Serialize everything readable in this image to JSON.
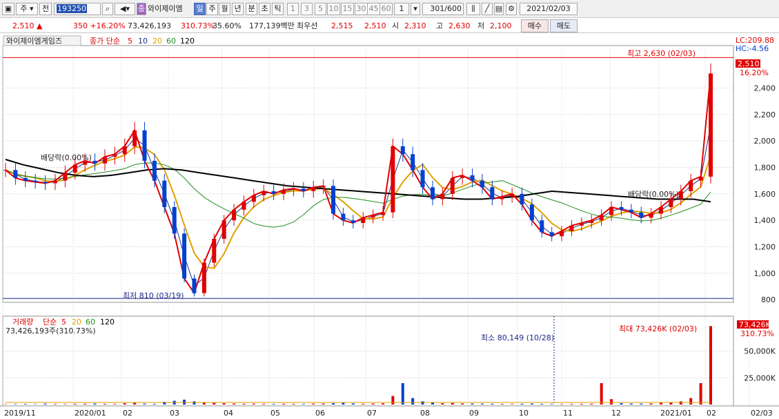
{
  "toolbar": {
    "market": "주",
    "kind": "전",
    "code": "193250",
    "badge": "종",
    "name": "와이제이엠",
    "periods": [
      "일",
      "주",
      "월",
      "년",
      "분",
      "초",
      "틱"
    ],
    "nums": [
      "1",
      "3",
      "5",
      "10",
      "15",
      "30",
      "45",
      "60"
    ],
    "unit": "1",
    "count": "301",
    "total": "/600",
    "date": "2021/02/03"
  },
  "quote": {
    "price": "2,510",
    "arrow": "▲",
    "change": "350",
    "rate": "+16.20%",
    "volume": "73,426,193",
    "vol_rate": "310.73%",
    "turnover": "35.60%",
    "amount": "177,139백만",
    "pref_label": "최우선",
    "ask": "2,515",
    "bid": "2,510",
    "open_label": "시",
    "open": "2,310",
    "high_label": "고",
    "high": "2,630",
    "low_label": "저",
    "low": "2,100",
    "buy": "매수",
    "sell": "매도"
  },
  "legend": {
    "name": "와이제이엠게임즈",
    "ma_label": "종가 단순",
    "periods": [
      "5",
      "10",
      "20",
      "60",
      "120"
    ]
  },
  "vol_legend": {
    "label": "거래량",
    "ma_label": "단순",
    "periods": [
      "5",
      "20",
      "60",
      "120"
    ],
    "value": "73,426,193주(310.73%)"
  },
  "annotations": {
    "lc": "LC:209.88",
    "hc": "HC:-4.56",
    "last_price": "2,510",
    "last_rate": "16.20%",
    "high": "최고 2,630 (02/03)",
    "low": "최저 810 (03/19)",
    "div1": "배당락(0.00%)",
    "div2": "배당락(0.00%)",
    "vol_max": "최대 73,426K (02/03)",
    "vol_min": "최소 80,149 (10/28)",
    "vol_last": "73,426K",
    "vol_rate": "310.73%"
  },
  "colors": {
    "up": "#e00000",
    "down": "#0040d0",
    "ma5": "#e00000",
    "ma10": "#203080",
    "ma20": "#e0a000",
    "ma60": "#209020",
    "ma120": "#000000"
  },
  "chart_data": {
    "type": "candlestick",
    "price_axis": {
      "ticks": [
        800,
        1000,
        1200,
        1400,
        1600,
        1800,
        2000,
        2200,
        2400
      ],
      "range": [
        780,
        2700
      ]
    },
    "volume_axis": {
      "ticks": [
        "25,000K",
        "50,000K"
      ],
      "max_k": 75000
    },
    "x_labels": [
      "2019/11",
      "2020/01",
      "02",
      "03",
      "04",
      "05",
      "06",
      "07",
      "08",
      "09",
      "10",
      "11",
      "12",
      "2021/01",
      "02",
      "02/03"
    ],
    "weekly_close": [
      1780,
      1720,
      1700,
      1690,
      1680,
      1700,
      1760,
      1820,
      1850,
      1830,
      1880,
      1900,
      1960,
      2080,
      1850,
      1700,
      1500,
      1300,
      960,
      850,
      1080,
      1260,
      1400,
      1480,
      1540,
      1590,
      1620,
      1600,
      1630,
      1640,
      1620,
      1650,
      1660,
      1450,
      1400,
      1380,
      1420,
      1440,
      1460,
      1960,
      1900,
      1780,
      1650,
      1560,
      1600,
      1720,
      1740,
      1700,
      1650,
      1560,
      1580,
      1600,
      1520,
      1400,
      1310,
      1280,
      1320,
      1360,
      1380,
      1400,
      1440,
      1500,
      1480,
      1460,
      1420,
      1450,
      1500,
      1560,
      1620,
      1700,
      1730,
      2510
    ],
    "series": [
      {
        "name": "5",
        "values": [
          1780,
          1720,
          1700,
          1690,
          1680,
          1700,
          1760,
          1820,
          1850,
          1830,
          1880,
          1900,
          1960,
          2080,
          1850,
          1700,
          1500,
          1300,
          960,
          850,
          1080,
          1260,
          1400,
          1480,
          1540,
          1590,
          1620,
          1600,
          1630,
          1640,
          1620,
          1650,
          1660,
          1450,
          1400,
          1380,
          1420,
          1440,
          1460,
          1960,
          1900,
          1780,
          1650,
          1560,
          1600,
          1720,
          1740,
          1700,
          1650,
          1560,
          1580,
          1600,
          1520,
          1400,
          1310,
          1280,
          1320,
          1360,
          1380,
          1400,
          1440,
          1500,
          1480,
          1460,
          1420,
          1450,
          1500,
          1560,
          1620,
          1700,
          1730,
          2510
        ]
      },
      {
        "name": "120",
        "values": [
          1860,
          1820,
          1790,
          1760,
          1740,
          1730,
          1740,
          1760,
          1780,
          1790,
          1780,
          1760,
          1740,
          1720,
          1700,
          1680,
          1660,
          1650,
          1640,
          1630,
          1620,
          1610,
          1600,
          1590,
          1580,
          1570,
          1560,
          1560,
          1570,
          1580,
          1600,
          1620,
          1610,
          1600,
          1590,
          1580,
          1570,
          1560,
          1560,
          1560,
          1540
        ]
      }
    ],
    "volume_k": [
      300,
      400,
      500,
      300,
      800,
      500,
      400,
      600,
      700,
      900,
      600,
      500,
      1200,
      1500,
      800,
      600,
      2500,
      3500,
      4500,
      3000,
      2000,
      1500,
      1200,
      900,
      700,
      800,
      600,
      500,
      700,
      600,
      500,
      800,
      900,
      1200,
      1500,
      1000,
      700,
      900,
      1100,
      8000,
      20000,
      6000,
      3000,
      1800,
      1200,
      1400,
      1000,
      900,
      800,
      700,
      600,
      500,
      700,
      900,
      600,
      500,
      400,
      500,
      600,
      700,
      20000,
      5000,
      1200,
      900,
      800,
      1000,
      1500,
      2000,
      3000,
      6000,
      20000,
      73426
    ]
  }
}
